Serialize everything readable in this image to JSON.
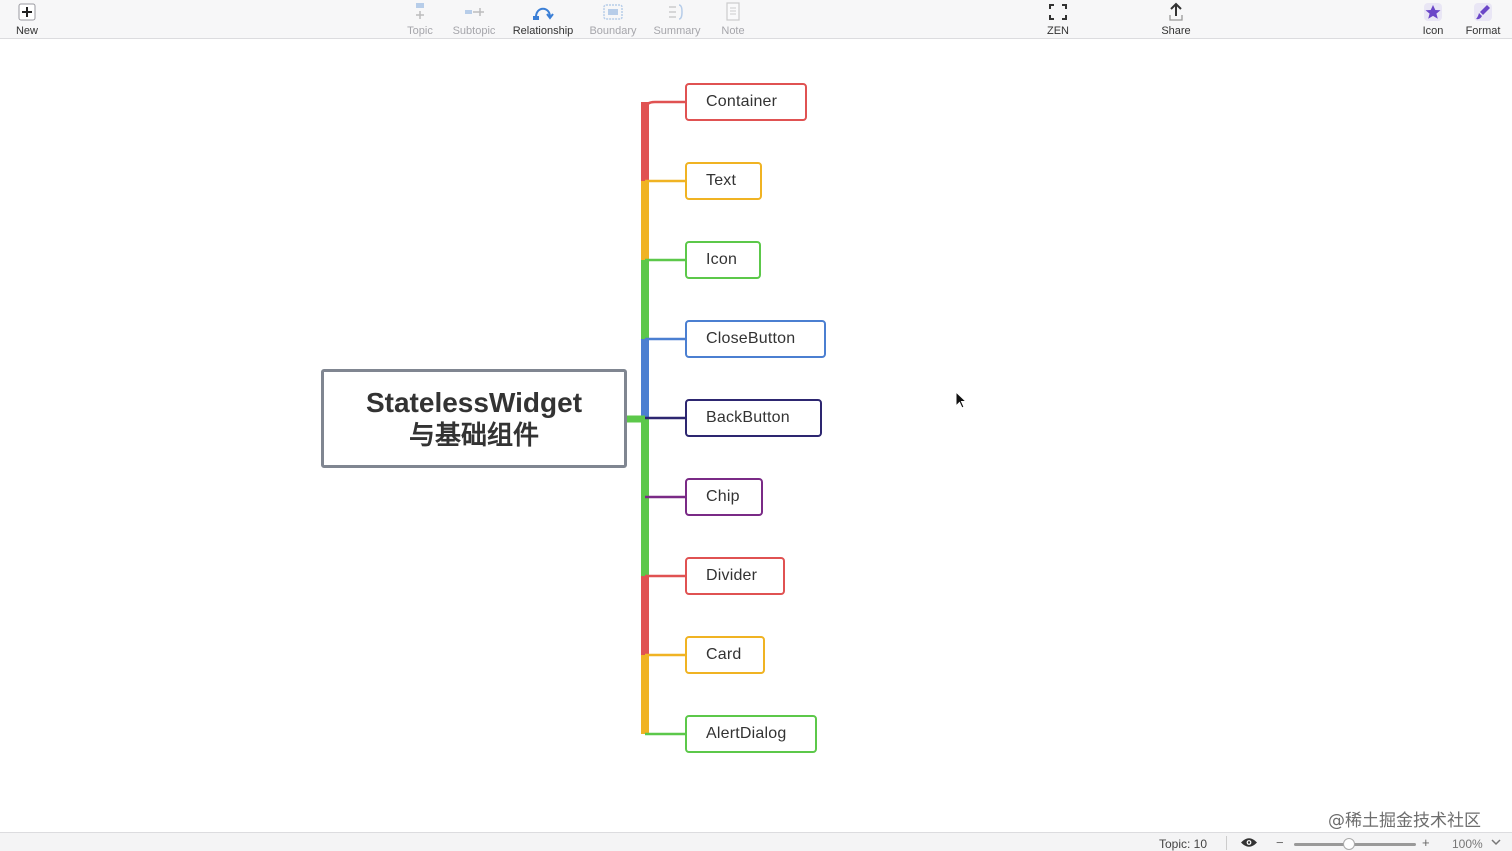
{
  "toolbar": {
    "left": [
      {
        "label": "New",
        "icon": "new-icon"
      }
    ],
    "center": [
      {
        "label": "Topic",
        "icon": "topic-icon",
        "enabled": false
      },
      {
        "label": "Subtopic",
        "icon": "subtopic-icon",
        "enabled": false
      },
      {
        "label": "Relationship",
        "icon": "relationship-icon",
        "enabled": true
      },
      {
        "label": "Boundary",
        "icon": "boundary-icon",
        "enabled": false
      },
      {
        "label": "Summary",
        "icon": "summary-icon",
        "enabled": false
      },
      {
        "label": "Note",
        "icon": "note-icon",
        "enabled": false
      }
    ],
    "zen": {
      "label": "ZEN",
      "icon": "zen-icon"
    },
    "share": {
      "label": "Share",
      "icon": "share-icon"
    },
    "right": [
      {
        "label": "Icon",
        "icon": "star-icon"
      },
      {
        "label": "Format",
        "icon": "format-brush-icon"
      }
    ]
  },
  "mindmap": {
    "root": {
      "line1": "StatelessWidget",
      "line2": "与基础组件"
    },
    "children": [
      {
        "label": "Container",
        "color": "#e05252"
      },
      {
        "label": "Text",
        "color": "#f0b323"
      },
      {
        "label": "Icon",
        "color": "#5cc84a"
      },
      {
        "label": "CloseButton",
        "color": "#4b7fd1"
      },
      {
        "label": "BackButton",
        "color": "#2d2670"
      },
      {
        "label": "Chip",
        "color": "#7a2a86"
      },
      {
        "label": "Divider",
        "color": "#e05252"
      },
      {
        "label": "Card",
        "color": "#f0b323"
      },
      {
        "label": "AlertDialog",
        "color": "#5cc84a"
      }
    ]
  },
  "statusbar": {
    "topic_count": "Topic: 10",
    "zoom_minus": "−",
    "zoom_plus": "+",
    "zoom_level": "100%",
    "zoom_fraction": 0.45
  },
  "watermark": "@稀土掘金技术社区"
}
